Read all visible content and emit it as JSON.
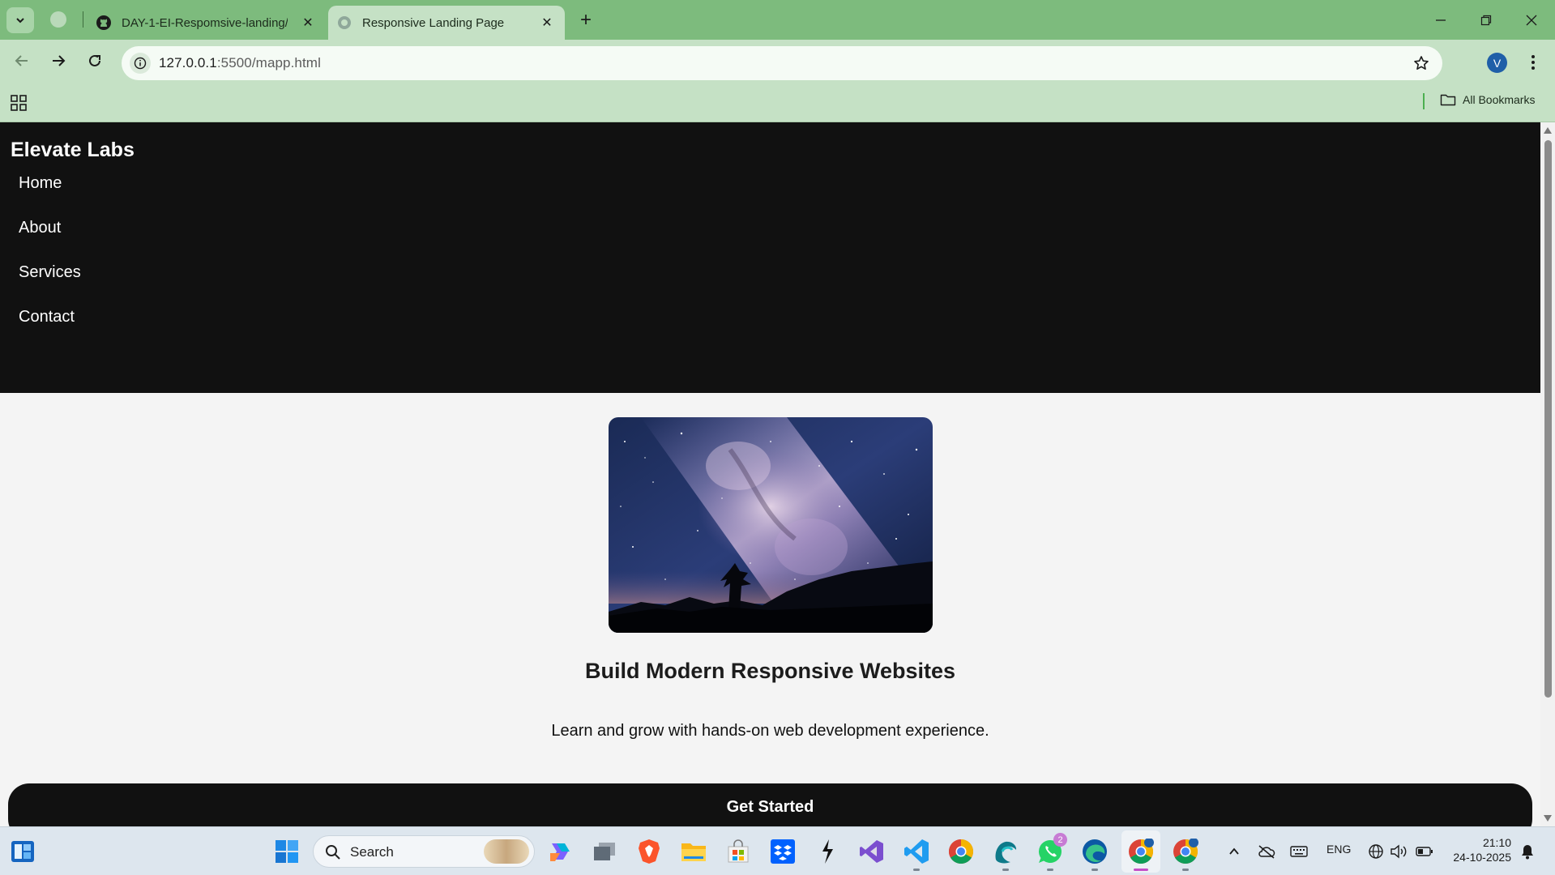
{
  "browser": {
    "tabs": [
      {
        "label": "DAY-1-EI-Respomsive-landing/",
        "favicon": "github-icon",
        "active": false
      },
      {
        "label": "Responsive Landing Page",
        "favicon": "globe-icon",
        "active": true
      }
    ],
    "url_host": "127.0.0.1",
    "url_path": ":5500/mapp.html",
    "profile_initial": "V",
    "bookmarks_label": "All Bookmarks",
    "colors": {
      "frame": "#7dbb7d",
      "toolbar": "#c5e1c5"
    }
  },
  "site": {
    "brand": "Elevate Labs",
    "nav": [
      "Home",
      "About",
      "Services",
      "Contact"
    ],
    "hero": {
      "image": "milky-way-night-sky",
      "title": "Build Modern Responsive Websites",
      "text": "Learn and grow with hands-on web development experience."
    },
    "cta_label": "Get Started",
    "colors": {
      "header": "#111111",
      "background": "#f4f4f4"
    }
  },
  "taskbar": {
    "search_label": "Search",
    "apps": [
      "start-icon",
      "copilot-icon",
      "task-view-icon",
      "brave-icon",
      "file-explorer-icon",
      "store-icon",
      "dropbox-icon",
      "cursor-icon",
      "visual-studio-icon",
      "vscode-icon",
      "chrome-icon",
      "edge-dev-icon",
      "whatsapp-icon",
      "edge-icon",
      "chrome-profile-icon",
      "chrome-profile-2-icon"
    ],
    "whatsapp_badge": "2",
    "language": "ENG",
    "time": "21:10",
    "date": "24-10-2025"
  }
}
